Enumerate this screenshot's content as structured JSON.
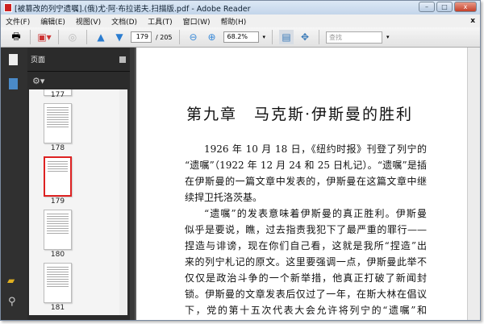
{
  "window": {
    "title": "[被篡改的列宁遗嘱].(俄)尤·阿·布拉诺夫.扫描版.pdf - Adobe Reader",
    "min": "–",
    "max": "□",
    "close": "x"
  },
  "menu": [
    "文件(F)",
    "编辑(E)",
    "视图(V)",
    "文档(D)",
    "工具(T)",
    "窗口(W)",
    "帮助(H)"
  ],
  "menu_close": "x",
  "toolbar": {
    "page_current": "179",
    "page_total": "/ 205",
    "zoom": "68.2%",
    "search_placeholder": "查找"
  },
  "panel": {
    "title": "页面",
    "thumbnails": [
      {
        "label": "177"
      },
      {
        "label": "178"
      },
      {
        "label": "179",
        "selected": true
      },
      {
        "label": "180"
      },
      {
        "label": "181"
      }
    ]
  },
  "document": {
    "chapter_title": "第九章　马克斯·伊斯曼的胜利",
    "lines": [
      "1926 年 10 月 18 日，《纽约时报》刊登了列宁的",
      "“遗嘱”（1922 年 12 月 24 和 25 日札记）。“遗嘱”是插",
      "在伊斯曼的一篇文章中发表的，伊斯曼在这篇文章中继",
      "续捍卫托洛茨基。",
      "“遗嘱”的发表意味着伊斯曼的真正胜利。伊斯曼",
      "似乎是要说，瞧，过去指责我犯下了最严重的罪行——",
      "捏造与诽谤，现在你们自己看，这就是我所“捏造”出",
      "来的列宁札记的原文。这里要强调一点，伊斯曼此举不",
      "仅仅是政治斗争的一个新举措，他真正打破了新闻封",
      "锁。伊斯曼的文章发表后仅过了一年，在斯大林在倡议",
      "下，党的第十五次代表大会允许将列宁的“遗嘱”和"
    ]
  }
}
